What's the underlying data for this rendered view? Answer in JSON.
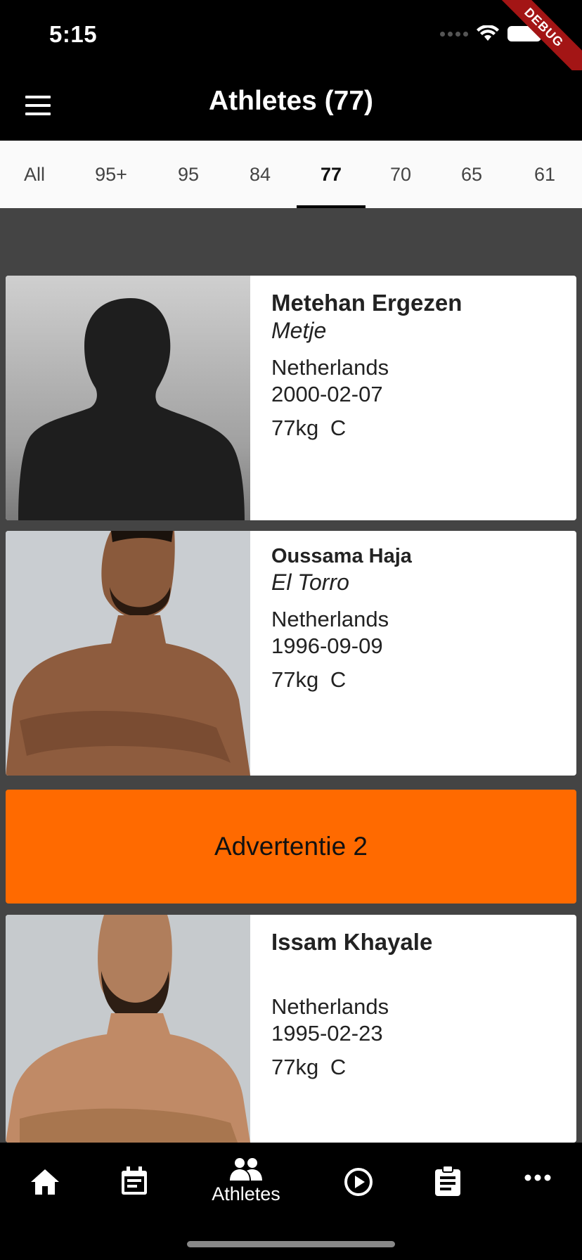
{
  "status_bar": {
    "time": "5:15",
    "debug_label": "DEBUG"
  },
  "app_bar": {
    "title": "Athletes (77)"
  },
  "tabs": [
    {
      "label": "All",
      "active": false
    },
    {
      "label": "95+",
      "active": false
    },
    {
      "label": "95",
      "active": false
    },
    {
      "label": "84",
      "active": false
    },
    {
      "label": "77",
      "active": true
    },
    {
      "label": "70",
      "active": false
    },
    {
      "label": "65",
      "active": false
    },
    {
      "label": "61",
      "active": false
    }
  ],
  "athletes": [
    {
      "name": "Metehan Ergezen",
      "nickname": "Metje",
      "country": "Netherlands",
      "dob": "2000-02-07",
      "weight": "77kg",
      "class": "C",
      "photo": "silhouette"
    },
    {
      "name": "Oussama Haja",
      "nickname": "El Torro",
      "country": "Netherlands",
      "dob": "1996-09-09",
      "weight": "77kg",
      "class": "C",
      "photo": "person"
    },
    {
      "name": "Issam Khayale",
      "nickname": "",
      "country": "Netherlands",
      "dob": "1995-02-23",
      "weight": "77kg",
      "class": "C",
      "photo": "person"
    }
  ],
  "ad": {
    "label": "Advertentie 2",
    "color": "#ff6a00"
  },
  "bottom_nav": [
    {
      "icon": "home-icon",
      "label": ""
    },
    {
      "icon": "calendar-icon",
      "label": ""
    },
    {
      "icon": "people-icon",
      "label": "Athletes"
    },
    {
      "icon": "play-circle-icon",
      "label": ""
    },
    {
      "icon": "clipboard-icon",
      "label": ""
    },
    {
      "icon": "more-icon",
      "label": ""
    }
  ]
}
